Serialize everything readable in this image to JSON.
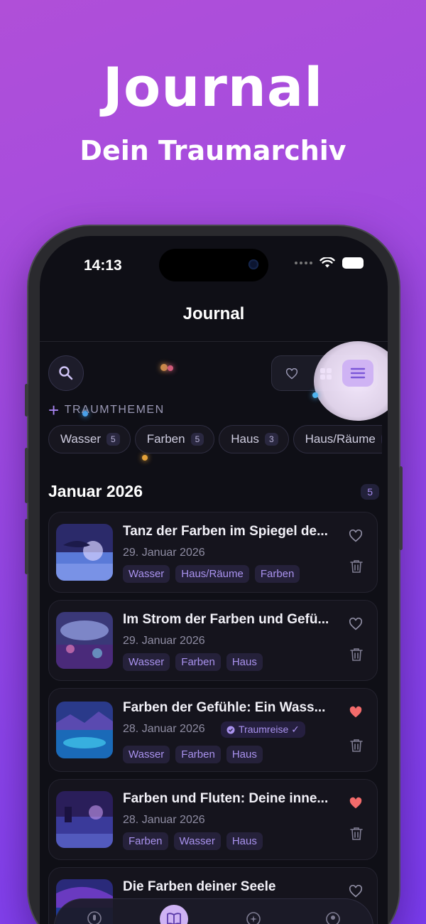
{
  "hero": {
    "title": "Journal",
    "subtitle": "Dein Traumarchiv"
  },
  "status_bar": {
    "time": "14:13"
  },
  "nav": {
    "title": "Journal"
  },
  "toolbar": {
    "view_mode": "list"
  },
  "themes": {
    "label": "TRAUMTHEMEN",
    "chips": [
      {
        "label": "Wasser",
        "count": "5"
      },
      {
        "label": "Farben",
        "count": "5"
      },
      {
        "label": "Haus",
        "count": "3"
      },
      {
        "label": "Haus/Räume",
        "count": ""
      }
    ]
  },
  "section": {
    "month": "Januar 2026",
    "count": "5"
  },
  "entries": [
    {
      "title": "Tanz der Farben im Spiegel de...",
      "date": "29. Januar 2026",
      "tags": [
        "Wasser",
        "Haus/Räume",
        "Farben"
      ],
      "favorite": false
    },
    {
      "title": "Im Strom der Farben und Gefü...",
      "date": "29. Januar 2026",
      "tags": [
        "Wasser",
        "Farben",
        "Haus"
      ],
      "favorite": false
    },
    {
      "title": "Farben der Gefühle: Ein Wass...",
      "date": "28. Januar 2026",
      "badge": "Traumreise ✓",
      "tags": [
        "Wasser",
        "Farben",
        "Haus"
      ],
      "favorite": true
    },
    {
      "title": "Farben und Fluten: Deine inne...",
      "date": "28. Januar 2026",
      "tags": [
        "Farben",
        "Wasser",
        "Haus"
      ],
      "favorite": true
    },
    {
      "title": "Die Farben deiner Seele",
      "date": "",
      "tags": [],
      "favorite": false
    }
  ],
  "colors": {
    "accent": "#a784f0",
    "heart_active": "#f26b6b",
    "background": "#0f0f16"
  },
  "icons": {
    "search": "search-icon",
    "heart": "heart-icon",
    "grid": "grid-icon",
    "list": "list-icon",
    "trash": "trash-icon",
    "mic": "mic-icon",
    "book": "book-icon",
    "magic": "sparkle-icon",
    "profile": "profile-icon"
  }
}
